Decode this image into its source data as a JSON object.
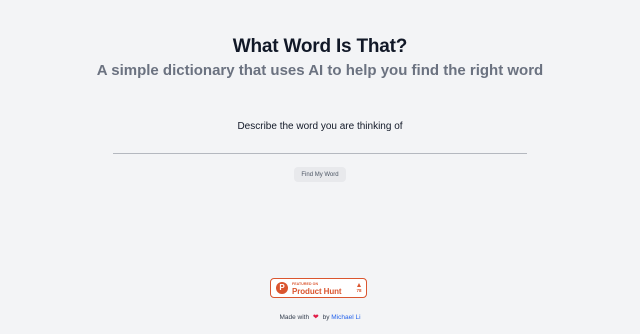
{
  "header": {
    "title": "What Word Is That?",
    "subtitle": "A simple dictionary that uses AI to help you find the right word"
  },
  "search": {
    "label": "Describe the word you are thinking of",
    "value": "",
    "placeholder": ""
  },
  "actions": {
    "find_label": "Find My Word"
  },
  "product_hunt": {
    "featured_label": "FEATURED ON",
    "name": "Product Hunt",
    "upvotes": "78",
    "logo_letter": "P",
    "brand_color": "#da552f"
  },
  "footer": {
    "made_with": "Made with",
    "heart_icon": "heart-icon",
    "by": "by",
    "author": "Michael Li"
  },
  "colors": {
    "background": "#f3f4f6",
    "title": "#111827",
    "subtitle": "#6b7280",
    "link": "#2563eb",
    "heart": "#e11d48"
  }
}
